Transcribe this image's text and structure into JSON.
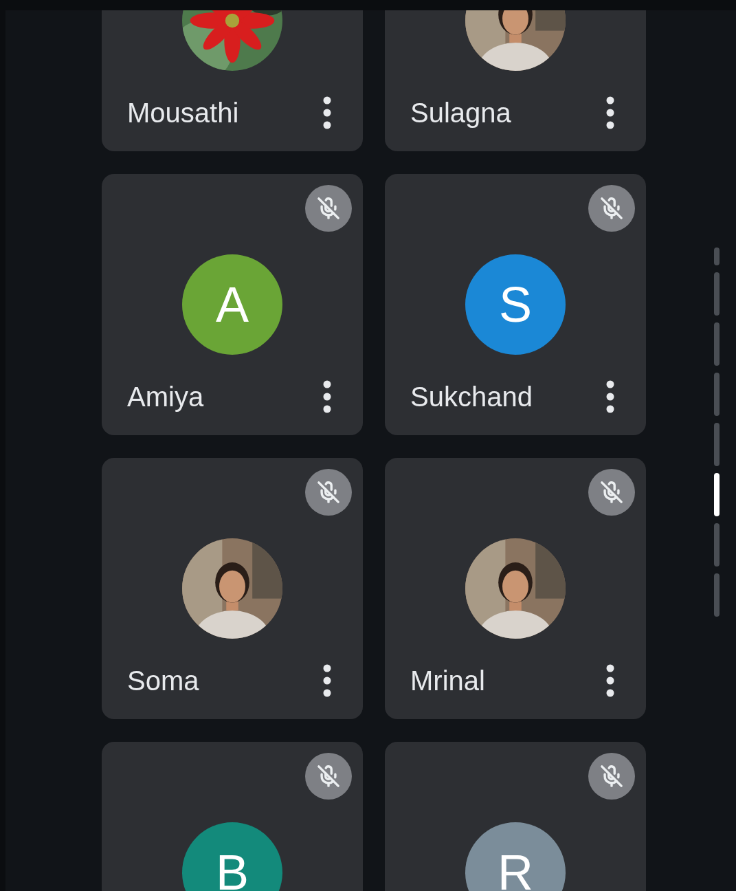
{
  "participants": [
    {
      "name": "Mousathi"
    },
    {
      "name": "Sulagna"
    },
    {
      "name": "Amiya",
      "muted": true,
      "avatar": {
        "kind": "initial",
        "letter": "A",
        "color": "#6aa536"
      }
    },
    {
      "name": "Sukchand",
      "muted": true,
      "avatar": {
        "kind": "initial",
        "letter": "S",
        "color": "#1b88d6"
      }
    },
    {
      "name": "Soma",
      "muted": true
    },
    {
      "name": "Mrinal",
      "muted": true
    },
    {
      "muted": true,
      "avatar": {
        "kind": "initial",
        "letter": "B",
        "color": "#138a7b"
      }
    },
    {
      "muted": true,
      "avatar": {
        "kind": "initial",
        "letter": "R",
        "color": "#7b8d9a"
      }
    }
  ],
  "pages": [
    {
      "selected": false
    },
    {
      "selected": false
    },
    {
      "selected": false
    },
    {
      "selected": false
    },
    {
      "selected": false
    },
    {
      "selected": true
    },
    {
      "selected": false
    },
    {
      "selected": false
    }
  ]
}
